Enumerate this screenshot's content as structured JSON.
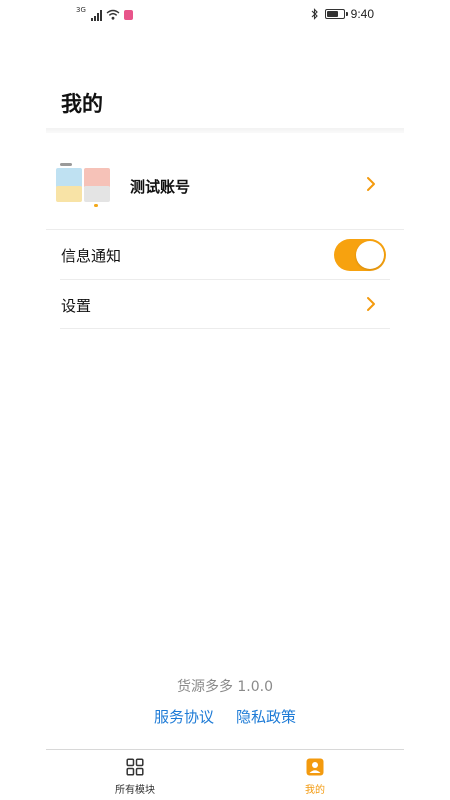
{
  "status_bar": {
    "network_type": "3G",
    "time": "9:40",
    "battery_level": 0.7
  },
  "page": {
    "title": "我的"
  },
  "account": {
    "name": "测试账号"
  },
  "settings": [
    {
      "label": "信息通知",
      "control": "toggle",
      "on": true
    },
    {
      "label": "设置",
      "control": "chevron"
    }
  ],
  "footer": {
    "version": "货源多多 1.0.0",
    "links": [
      "服务协议",
      "隐私政策"
    ]
  },
  "tab_bar": {
    "tabs": [
      {
        "label": "所有模块",
        "icon": "grid-icon",
        "active": false
      },
      {
        "label": "我的",
        "icon": "profile-icon",
        "active": true
      }
    ]
  },
  "colors": {
    "accent": "#f7a20f",
    "link": "#1e7bd6",
    "version_text": "#8a8a8a"
  }
}
